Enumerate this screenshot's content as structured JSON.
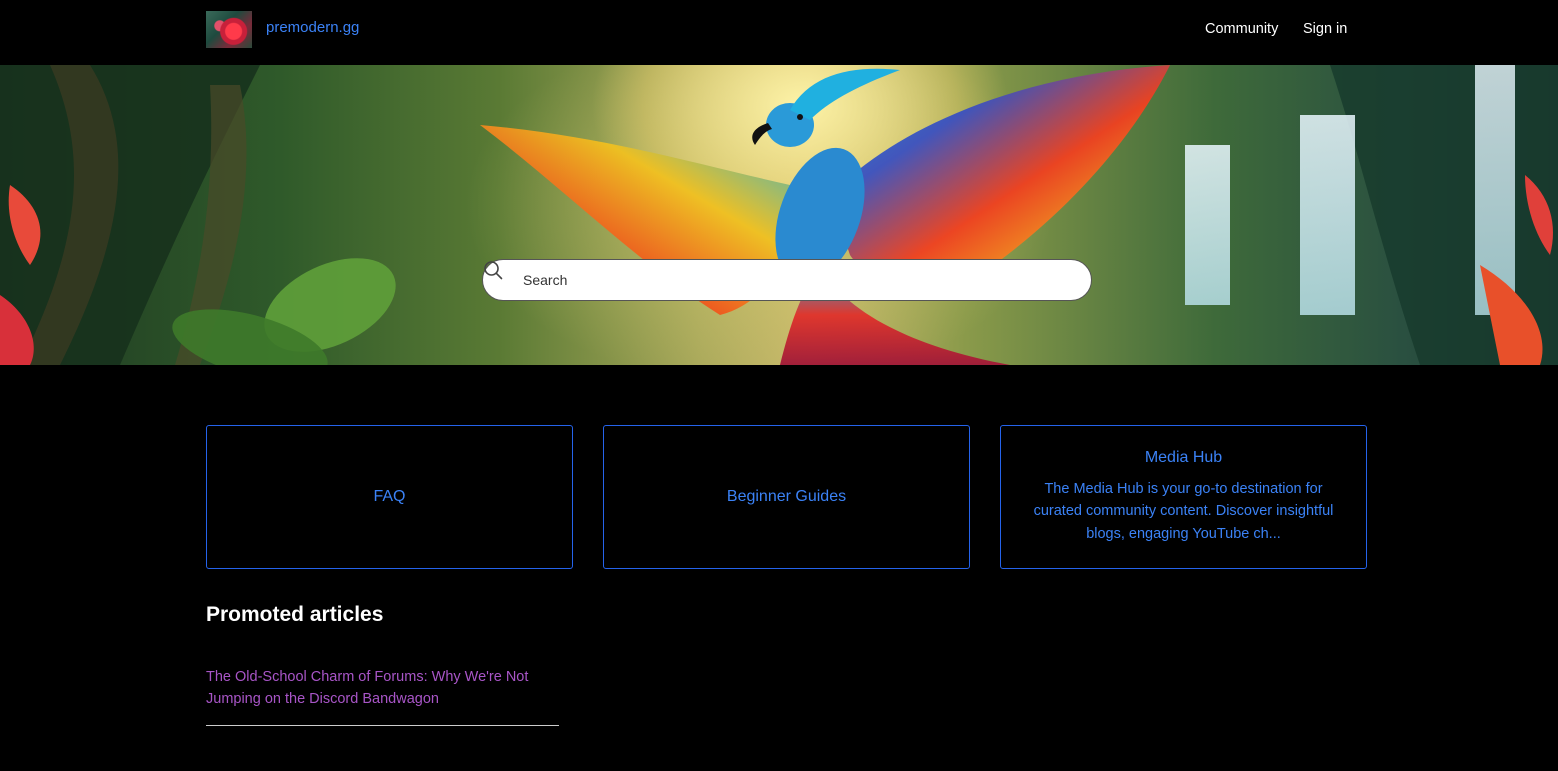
{
  "header": {
    "brand": "premodern.gg",
    "nav": {
      "community": "Community",
      "sign_in": "Sign in"
    }
  },
  "search": {
    "placeholder": "Search",
    "icon": "search-icon"
  },
  "categories": [
    {
      "title": "FAQ",
      "description": ""
    },
    {
      "title": "Beginner Guides",
      "description": ""
    },
    {
      "title": "Media Hub",
      "description": "The Media Hub is your go-to destination for curated community content. Discover insightful blogs, engaging YouTube ch..."
    }
  ],
  "promoted": {
    "title": "Promoted articles",
    "articles": [
      {
        "title": "The Old-School Charm of Forums: Why We're Not Jumping on the Discord Bandwagon"
      }
    ]
  },
  "colors": {
    "link": "#3b82f6",
    "card_border": "#2563eb",
    "visited_link": "#a855c7",
    "background": "#000000"
  }
}
